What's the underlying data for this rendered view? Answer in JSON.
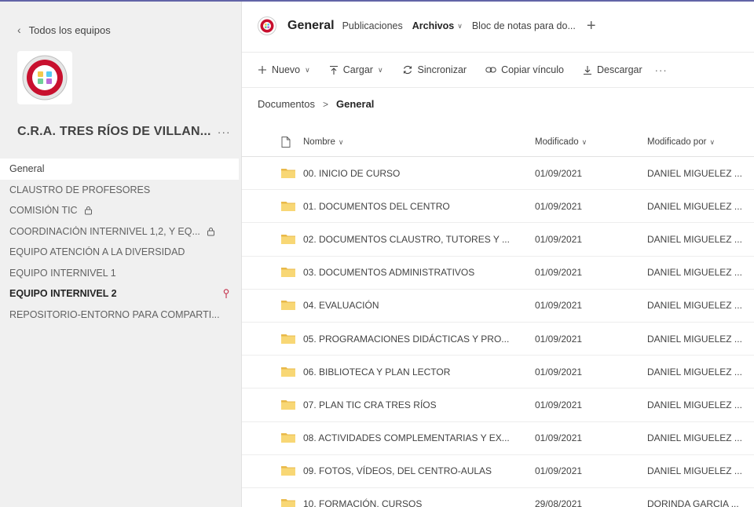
{
  "sidebar": {
    "back_label": "Todos los equipos",
    "team_name": "C.R.A. TRES RÍOS DE VILLAN...",
    "more": "···",
    "channels": [
      {
        "label": "General",
        "active": true
      },
      {
        "label": "CLAUSTRO DE PROFESORES"
      },
      {
        "label": "COMISIÓN TIC",
        "lock": true
      },
      {
        "label": "COORDINACIÓN INTERNIVEL 1,2, Y EQ...",
        "lock": true
      },
      {
        "label": "EQUIPO ATENCIÓN A LA DIVERSIDAD"
      },
      {
        "label": "EQUIPO INTERNIVEL 1"
      },
      {
        "label": "EQUIPO INTERNIVEL 2",
        "bold": true,
        "pin": true
      },
      {
        "label": "REPOSITORIO-ENTORNO PARA COMPARTI..."
      }
    ]
  },
  "header": {
    "channel_title": "General",
    "tabs": [
      {
        "label": "Publicaciones"
      },
      {
        "label": "Archivos",
        "active": true,
        "dropdown": "∨"
      },
      {
        "label": "Bloc de notas para do..."
      }
    ],
    "add": "+"
  },
  "toolbar": {
    "new_label": "Nuevo",
    "upload_label": "Cargar",
    "sync_label": "Sincronizar",
    "copy_link_label": "Copiar vínculo",
    "download_label": "Descargar",
    "more": "···",
    "chevron": "∨"
  },
  "breadcrumb": {
    "root": "Documentos",
    "sep": ">",
    "current": "General"
  },
  "files": {
    "columns": {
      "name": "Nombre",
      "modified": "Modificado",
      "modified_by": "Modificado por",
      "sort_glyph": "∨"
    },
    "rows": [
      {
        "name": "00. INICIO DE CURSO",
        "modified": "01/09/2021",
        "by": "DANIEL MIGUELEZ ..."
      },
      {
        "name": "01. DOCUMENTOS DEL CENTRO",
        "modified": "01/09/2021",
        "by": "DANIEL MIGUELEZ ..."
      },
      {
        "name": "02. DOCUMENTOS CLAUSTRO, TUTORES Y ...",
        "modified": "01/09/2021",
        "by": "DANIEL MIGUELEZ ..."
      },
      {
        "name": "03. DOCUMENTOS ADMINISTRATIVOS",
        "modified": "01/09/2021",
        "by": "DANIEL MIGUELEZ ..."
      },
      {
        "name": "04. EVALUACIÓN",
        "modified": "01/09/2021",
        "by": "DANIEL MIGUELEZ ..."
      },
      {
        "name": "05. PROGRAMACIONES DIDÁCTICAS Y PRO...",
        "modified": "01/09/2021",
        "by": "DANIEL MIGUELEZ ..."
      },
      {
        "name": "06. BIBLIOTECA Y PLAN LECTOR",
        "modified": "01/09/2021",
        "by": "DANIEL MIGUELEZ ..."
      },
      {
        "name": "07. PLAN TIC CRA TRES RÍOS",
        "modified": "01/09/2021",
        "by": "DANIEL MIGUELEZ ..."
      },
      {
        "name": "08. ACTIVIDADES COMPLEMENTARIAS Y EX...",
        "modified": "01/09/2021",
        "by": "DANIEL MIGUELEZ ..."
      },
      {
        "name": "09. FOTOS, VÍDEOS, DEL CENTRO-AULAS",
        "modified": "01/09/2021",
        "by": "DANIEL MIGUELEZ ..."
      },
      {
        "name": "10. FORMACIÓN, CURSOS",
        "modified": "29/08/2021",
        "by": "DORINDA GARCIA ..."
      }
    ]
  },
  "colors": {
    "accent": "#6264a7",
    "folder": "#f8d775",
    "folder_tab": "#e9b949",
    "pin": "#c4314b",
    "logo_red": "#c8102e"
  }
}
